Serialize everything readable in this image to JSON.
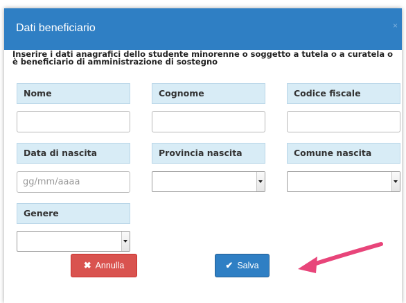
{
  "dialog": {
    "title": "Dati beneficiario",
    "close_label": "×"
  },
  "intro_text": "Inserire i dati anagrafici dello studente minorenne o soggetto a tutela o a curatela o è beneficiario di amministrazione di sostegno",
  "fields": {
    "nome": {
      "label": "Nome",
      "value": ""
    },
    "cognome": {
      "label": "Cognome",
      "value": ""
    },
    "codice_fiscale": {
      "label": "Codice fiscale",
      "value": ""
    },
    "data_nascita": {
      "label": "Data di nascita",
      "placeholder": "gg/mm/aaaa"
    },
    "provincia_nascita": {
      "label": "Provincia nascita",
      "selected": ""
    },
    "comune_nascita": {
      "label": "Comune nascita",
      "selected": ""
    },
    "genere": {
      "label": "Genere",
      "selected": ""
    }
  },
  "buttons": {
    "cancel": {
      "label": "Annulla",
      "icon": "times-icon"
    },
    "save": {
      "label": "Salva",
      "icon": "check-icon"
    }
  },
  "colors": {
    "header": "#2f7fc4",
    "label_bg": "#d8ecf6",
    "cancel": "#d9534f",
    "save": "#2f7fc4",
    "arrow": "#e8457a"
  }
}
